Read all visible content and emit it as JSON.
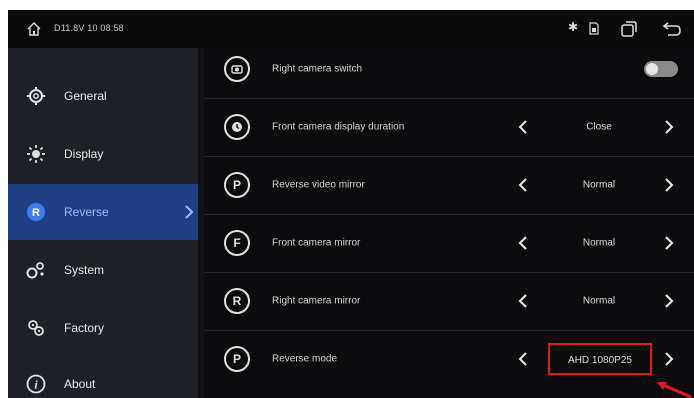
{
  "status_bar": {
    "text": "D11.8V  10  08:58",
    "icons": [
      "home-icon",
      "bluetooth-icon",
      "sd-card-icon",
      "windows-icon",
      "back-icon"
    ]
  },
  "sidebar": {
    "items": [
      {
        "label": "General",
        "icon": "gear-icon"
      },
      {
        "label": "Display",
        "icon": "brightness-icon"
      },
      {
        "label": "Reverse",
        "icon": "reverse-icon",
        "active": true
      },
      {
        "label": "System",
        "icon": "system-icon"
      },
      {
        "label": "Factory",
        "icon": "factory-icon"
      },
      {
        "label": "About",
        "icon": "info-icon"
      }
    ]
  },
  "settings": {
    "rows": [
      {
        "label": "Right camera switch",
        "icon": "camera-icon",
        "control": "toggle",
        "toggle_on": false
      },
      {
        "label": "Front camera display duration",
        "icon": "clock-icon",
        "control": "selector",
        "value": "Close"
      },
      {
        "label": "Reverse video mirror",
        "icon": "P",
        "control": "selector",
        "value": "Normal"
      },
      {
        "label": "Front camera mirror",
        "icon": "F",
        "control": "selector",
        "value": "Normal"
      },
      {
        "label": "Right camera mirror",
        "icon": "R",
        "control": "selector",
        "value": "Normal"
      },
      {
        "label": "Reverse mode",
        "icon": "P",
        "control": "selector",
        "value": "AHD 1080P25",
        "highlighted": true
      }
    ]
  },
  "colors": {
    "background": "#0c0c0e",
    "sidebar": "#1d2026",
    "active_item": "#1f3f82",
    "highlight_box": "#e11b1b"
  }
}
